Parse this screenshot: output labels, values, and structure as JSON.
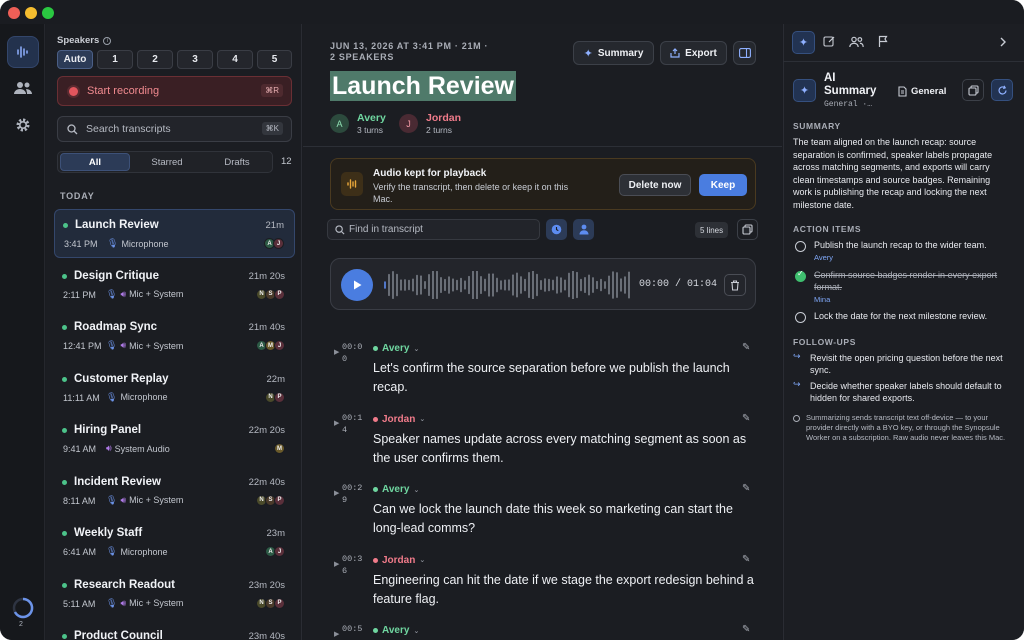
{
  "sidebar": {
    "progress_count": "2"
  },
  "list": {
    "speakers_label": "Speakers",
    "speaker_options": [
      "Auto",
      "1",
      "2",
      "3",
      "4",
      "5"
    ],
    "record_label": "Start recording",
    "record_shortcut": "⌘R",
    "search_placeholder": "Search transcripts",
    "search_shortcut": "⌘K",
    "filters": [
      "All",
      "Starred",
      "Drafts"
    ],
    "count": "12",
    "section_today": "TODAY",
    "items": [
      {
        "title": "Launch Review",
        "duration": "21m",
        "time": "3:41 PM",
        "source": "Microphone",
        "avatars": [
          "A",
          "J"
        ]
      },
      {
        "title": "Design Critique",
        "duration": "21m 20s",
        "time": "2:11 PM",
        "source": "Mic + System",
        "avatars": [
          "N",
          "S",
          "P"
        ]
      },
      {
        "title": "Roadmap Sync",
        "duration": "21m 40s",
        "time": "12:41 PM",
        "source": "Mic + System",
        "avatars": [
          "A",
          "M",
          "J"
        ]
      },
      {
        "title": "Customer Replay",
        "duration": "22m",
        "time": "11:11 AM",
        "source": "Microphone",
        "avatars": [
          "N",
          "P"
        ]
      },
      {
        "title": "Hiring Panel",
        "duration": "22m 20s",
        "time": "9:41 AM",
        "source": "System Audio",
        "avatars": [
          "M"
        ]
      },
      {
        "title": "Incident Review",
        "duration": "22m 40s",
        "time": "8:11 AM",
        "source": "Mic + System",
        "avatars": [
          "N",
          "S",
          "P"
        ]
      },
      {
        "title": "Weekly Staff",
        "duration": "23m",
        "time": "6:41 AM",
        "source": "Microphone",
        "avatars": [
          "A",
          "J"
        ]
      },
      {
        "title": "Research Readout",
        "duration": "23m 20s",
        "time": "5:11 AM",
        "source": "Mic + System",
        "avatars": [
          "N",
          "S",
          "P"
        ]
      },
      {
        "title": "Product Council",
        "duration": "23m 40s",
        "time": "",
        "source": "",
        "avatars": []
      }
    ]
  },
  "main": {
    "meta_line1": "JUN 13, 2026 AT 3:41 PM · 21M ·",
    "meta_line2": "2 SPEAKERS",
    "title": "Launch Review",
    "summary_btn": "Summary",
    "export_btn": "Export",
    "speakers": [
      {
        "initial": "A",
        "name": "Avery",
        "turns": "3 turns"
      },
      {
        "initial": "J",
        "name": "Jordan",
        "turns": "2 turns"
      }
    ],
    "banner": {
      "title": "Audio kept for playback",
      "body": "Verify the transcript, then delete or keep it on this Mac.",
      "delete_btn": "Delete now",
      "keep_btn": "Keep"
    },
    "find_placeholder": "Find in transcript",
    "lines_badge": "5 lines",
    "player": {
      "time": "00:00 / 01:04"
    },
    "segments": [
      {
        "ts1": "00:0",
        "ts2": "0",
        "speaker": "Avery",
        "text": "Let's confirm the source separation before we publish the launch recap."
      },
      {
        "ts1": "00:1",
        "ts2": "4",
        "speaker": "Jordan",
        "text": "Speaker names update across every matching segment as soon as the user confirms them."
      },
      {
        "ts1": "00:2",
        "ts2": "9",
        "speaker": "Avery",
        "text": "Can we lock the launch date this week so marketing can start the long-lead comms?"
      },
      {
        "ts1": "00:3",
        "ts2": "6",
        "speaker": "Jordan",
        "text": "Engineering can hit the date if we stage the export redesign behind a feature flag."
      },
      {
        "ts1": "00:5",
        "ts2": "",
        "speaker": "Avery",
        "text": ""
      }
    ]
  },
  "right": {
    "title_line1": "AI",
    "title_line2": "Summary",
    "subtitle": "General ·…",
    "template_btn": "General",
    "summary_heading": "SUMMARY",
    "summary_text": "The team aligned on the launch recap: source separation is confirmed, speaker labels propagate across matching segments, and exports will carry clean timestamps and source badges. Remaining work is publishing the recap and locking the next milestone date.",
    "action_heading": "ACTION ITEMS",
    "actions": [
      {
        "text": "Publish the launch recap to the wider team.",
        "owner": "Avery",
        "done": false
      },
      {
        "text": "Confirm source badges render in every export format.",
        "owner": "Mina",
        "done": true
      },
      {
        "text": "Lock the date for the next milestone review.",
        "owner": "",
        "done": false
      }
    ],
    "followup_heading": "FOLLOW-UPS",
    "followups": [
      "Revisit the open pricing question before the next sync.",
      "Decide whether speaker labels should default to hidden for shared exports."
    ],
    "privacy_note": "Summarizing sends transcript text off-device — to your provider directly with a BYO key, or through the Synopsule Worker on a subscription. Raw audio never leaves this Mac."
  }
}
